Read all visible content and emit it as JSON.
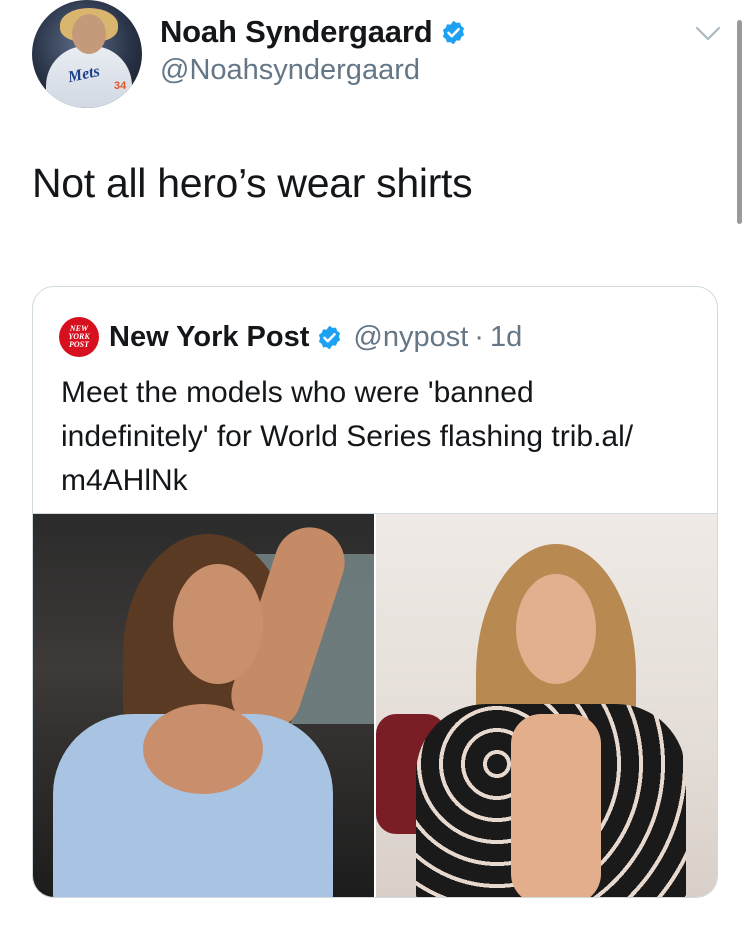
{
  "author": {
    "name": "Noah Syndergaard",
    "handle": "@Noahsyndergaard",
    "avatar_jersey_text": "Mets",
    "avatar_jersey_number": "34"
  },
  "tweet": {
    "text": "Not all hero’s wear shirts"
  },
  "quoted": {
    "logo_lines": [
      "NEW",
      "YORK",
      "POST"
    ],
    "name": "New York Post",
    "handle": "@nypost",
    "separator": "·",
    "time": "1d",
    "text_lines": [
      "Meet the models who were 'banned",
      "indefinitely' for World Series flashing trib.al/",
      "m4AHlNk"
    ]
  },
  "icons": {
    "verified": "verified-badge-icon",
    "menu": "chevron-down-icon"
  },
  "colors": {
    "verified_blue": "#1da1f2",
    "nyp_red": "#d6101e",
    "secondary_text": "#657786",
    "border": "#cfd9de"
  }
}
